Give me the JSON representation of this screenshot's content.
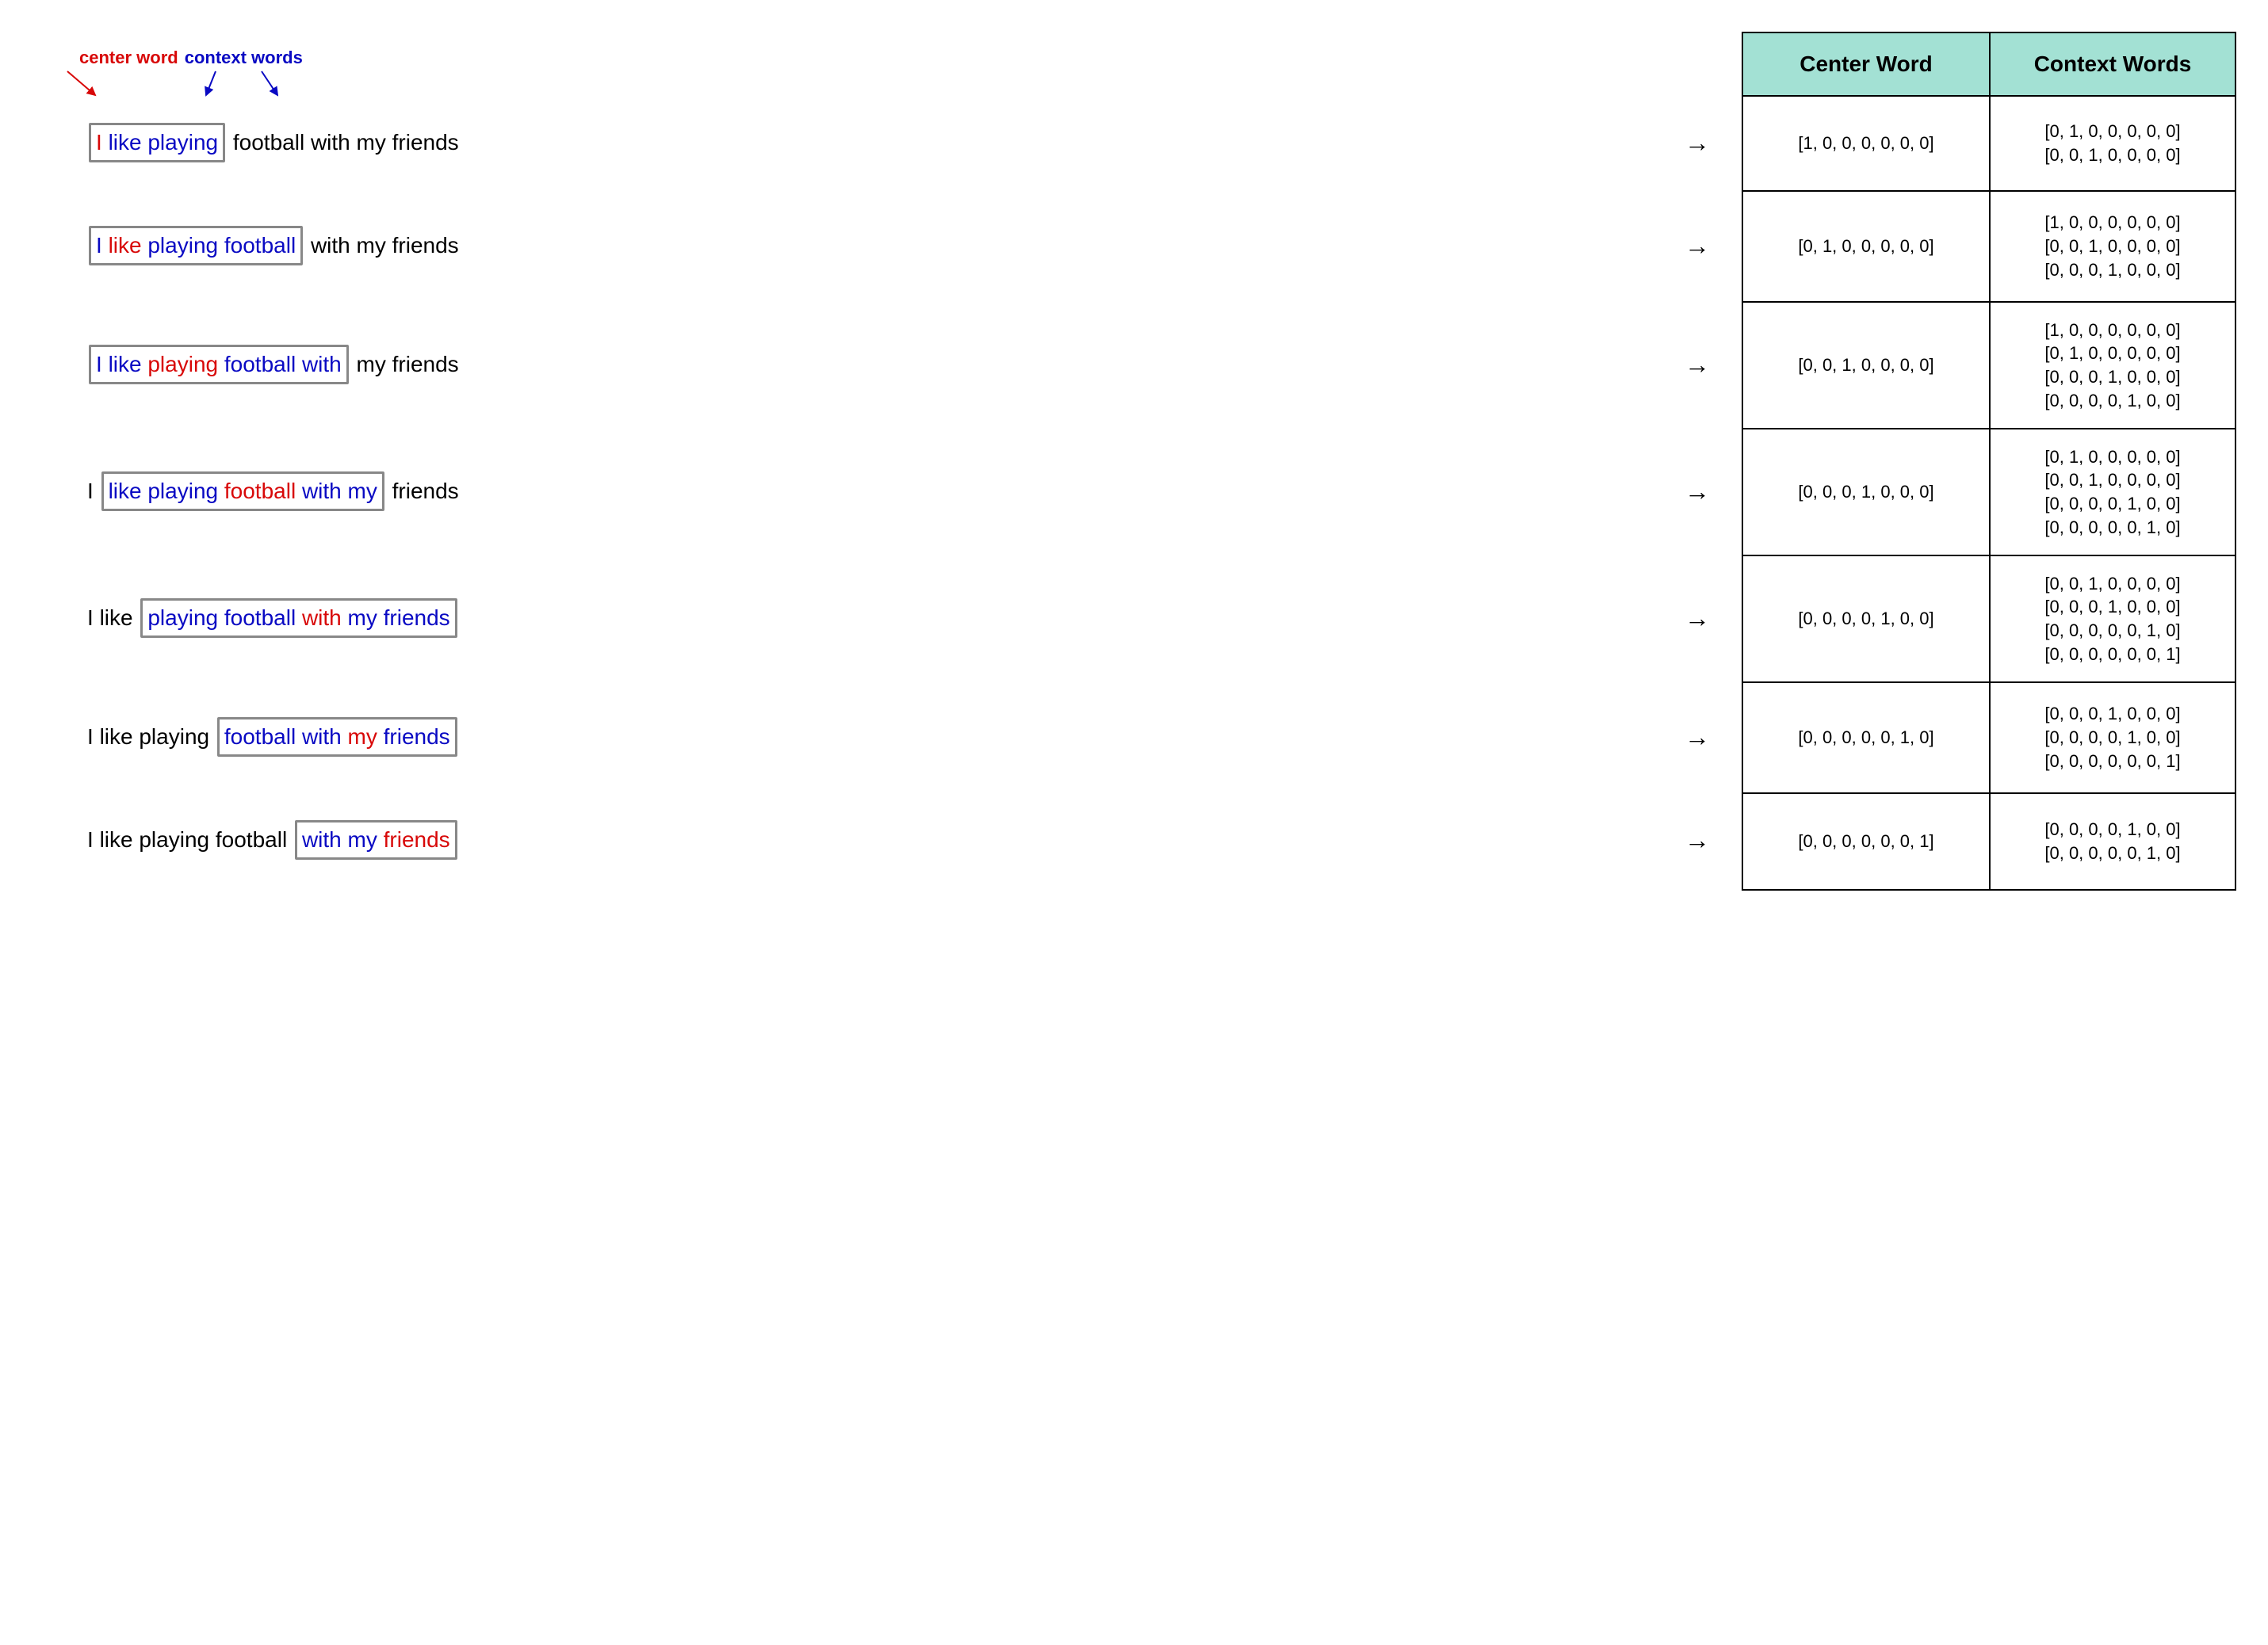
{
  "legend": {
    "center_label": "center word",
    "context_label": "context words"
  },
  "table_headers": {
    "center": "Center Word",
    "context": "Context Words"
  },
  "arrow": "→",
  "sentence_words": [
    "I",
    "like",
    "playing",
    "football",
    "with",
    "my",
    "friends"
  ],
  "rows": [
    {
      "height": "h120",
      "words": [
        {
          "t": "I",
          "role": "center",
          "boxed": true
        },
        {
          "t": "like",
          "role": "context",
          "boxed": true
        },
        {
          "t": "playing",
          "role": "context",
          "boxed": true
        },
        {
          "t": "football",
          "role": "plain",
          "boxed": false
        },
        {
          "t": "with",
          "role": "plain",
          "boxed": false
        },
        {
          "t": "my",
          "role": "plain",
          "boxed": false
        },
        {
          "t": "friends",
          "role": "plain",
          "boxed": false
        }
      ],
      "center_vec": "[1, 0, 0, 0, 0, 0, 0]",
      "context_vecs": [
        "[0, 1, 0, 0, 0, 0, 0]",
        "[0, 0, 1, 0, 0, 0, 0]"
      ]
    },
    {
      "height": "h140",
      "words": [
        {
          "t": "I",
          "role": "context",
          "boxed": true
        },
        {
          "t": "like",
          "role": "center",
          "boxed": true
        },
        {
          "t": "playing",
          "role": "context",
          "boxed": true
        },
        {
          "t": "football",
          "role": "context",
          "boxed": true
        },
        {
          "t": "with",
          "role": "plain",
          "boxed": false
        },
        {
          "t": "my",
          "role": "plain",
          "boxed": false
        },
        {
          "t": "friends",
          "role": "plain",
          "boxed": false
        }
      ],
      "center_vec": "[0, 1, 0, 0, 0, 0, 0]",
      "context_vecs": [
        "[1, 0, 0, 0, 0, 0, 0]",
        "[0, 0, 1, 0, 0, 0, 0]",
        "[0, 0, 0, 1, 0, 0, 0]"
      ]
    },
    {
      "height": "h160",
      "words": [
        {
          "t": "I",
          "role": "context",
          "boxed": true
        },
        {
          "t": "like",
          "role": "context",
          "boxed": true
        },
        {
          "t": "playing",
          "role": "center",
          "boxed": true
        },
        {
          "t": "football",
          "role": "context",
          "boxed": true
        },
        {
          "t": "with",
          "role": "context",
          "boxed": true
        },
        {
          "t": "my",
          "role": "plain",
          "boxed": false
        },
        {
          "t": "friends",
          "role": "plain",
          "boxed": false
        }
      ],
      "center_vec": "[0, 0, 1, 0, 0, 0, 0]",
      "context_vecs": [
        "[1, 0, 0, 0, 0, 0, 0]",
        "[0, 1, 0, 0, 0, 0, 0]",
        "[0, 0, 0, 1, 0, 0, 0]",
        "[0, 0, 0, 0, 1, 0, 0]"
      ]
    },
    {
      "height": "h160",
      "words": [
        {
          "t": "I",
          "role": "plain",
          "boxed": false
        },
        {
          "t": "like",
          "role": "context",
          "boxed": true
        },
        {
          "t": "playing",
          "role": "context",
          "boxed": true
        },
        {
          "t": "football",
          "role": "center",
          "boxed": true
        },
        {
          "t": "with",
          "role": "context",
          "boxed": true
        },
        {
          "t": "my",
          "role": "context",
          "boxed": true
        },
        {
          "t": "friends",
          "role": "plain",
          "boxed": false
        }
      ],
      "center_vec": "[0, 0, 0, 1, 0, 0, 0]",
      "context_vecs": [
        "[0, 1, 0, 0, 0, 0, 0]",
        "[0, 0, 1, 0, 0, 0, 0]",
        "[0, 0, 0, 0, 1, 0, 0]",
        "[0, 0, 0, 0, 0, 1, 0]"
      ]
    },
    {
      "height": "h160",
      "words": [
        {
          "t": "I",
          "role": "plain",
          "boxed": false
        },
        {
          "t": "like",
          "role": "plain",
          "boxed": false
        },
        {
          "t": "playing",
          "role": "context",
          "boxed": true
        },
        {
          "t": "football",
          "role": "context",
          "boxed": true
        },
        {
          "t": "with",
          "role": "center",
          "boxed": true
        },
        {
          "t": "my",
          "role": "context",
          "boxed": true
        },
        {
          "t": "friends",
          "role": "context",
          "boxed": true
        }
      ],
      "center_vec": "[0, 0, 0, 0, 1, 0, 0]",
      "context_vecs": [
        "[0, 0, 1, 0, 0, 0, 0]",
        "[0, 0, 0, 1, 0, 0, 0]",
        "[0, 0, 0, 0, 0, 1, 0]",
        "[0, 0, 0, 0, 0, 0, 1]"
      ]
    },
    {
      "height": "h140",
      "words": [
        {
          "t": "I",
          "role": "plain",
          "boxed": false
        },
        {
          "t": "like",
          "role": "plain",
          "boxed": false
        },
        {
          "t": "playing",
          "role": "plain",
          "boxed": false
        },
        {
          "t": "football",
          "role": "context",
          "boxed": true
        },
        {
          "t": "with",
          "role": "context",
          "boxed": true
        },
        {
          "t": "my",
          "role": "center",
          "boxed": true
        },
        {
          "t": "friends",
          "role": "context",
          "boxed": true
        }
      ],
      "center_vec": "[0, 0, 0, 0, 0, 1, 0]",
      "context_vecs": [
        "[0, 0, 0, 1, 0, 0, 0]",
        "[0, 0, 0, 0, 1, 0, 0]",
        "[0, 0, 0, 0, 0, 0, 1]"
      ]
    },
    {
      "height": "h120",
      "words": [
        {
          "t": "I",
          "role": "plain",
          "boxed": false
        },
        {
          "t": "like",
          "role": "plain",
          "boxed": false
        },
        {
          "t": "playing",
          "role": "plain",
          "boxed": false
        },
        {
          "t": "football",
          "role": "plain",
          "boxed": false
        },
        {
          "t": "with",
          "role": "context",
          "boxed": true
        },
        {
          "t": "my",
          "role": "context",
          "boxed": true
        },
        {
          "t": "friends",
          "role": "center",
          "boxed": true
        }
      ],
      "center_vec": "[0, 0, 0, 0, 0, 0, 1]",
      "context_vecs": [
        "[0, 0, 0, 0, 1, 0, 0]",
        "[0, 0, 0, 0, 0, 1, 0]"
      ]
    }
  ]
}
